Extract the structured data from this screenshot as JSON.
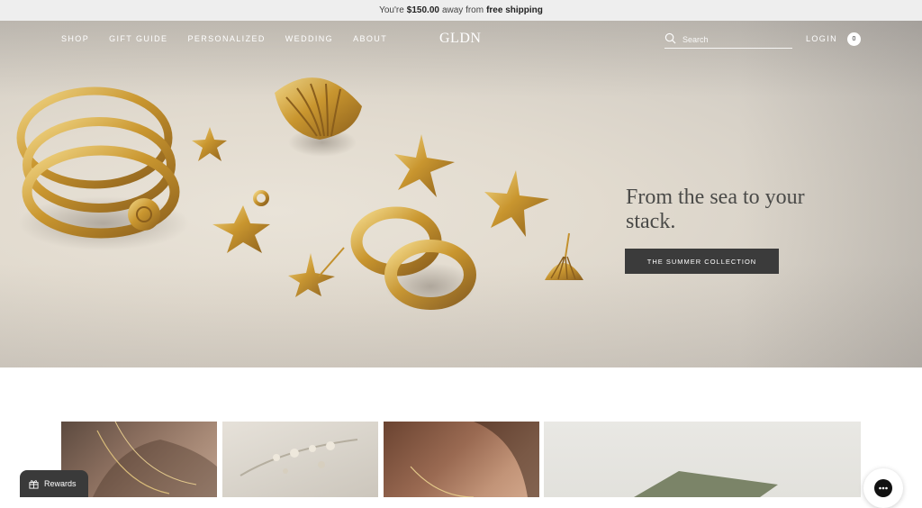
{
  "promo": {
    "prefix": "You're",
    "amount": "$150.00",
    "middle": "away from",
    "suffix": "free shipping"
  },
  "nav": {
    "links": [
      "SHOP",
      "GIFT GUIDE",
      "PERSONALIZED",
      "WEDDING",
      "ABOUT"
    ],
    "logo": "GLDN",
    "search_placeholder": "Search",
    "login": "LOGIN",
    "cart_count": "0"
  },
  "hero": {
    "title": "From the sea to your stack.",
    "cta": "THE SUMMER COLLECTION"
  },
  "rewards": {
    "label": "Rewards"
  },
  "colors": {
    "button_dark": "#3b3b3b",
    "promo_bg": "#eeeeee",
    "gold": "#c9a04a"
  },
  "icons": [
    "search-icon",
    "cart-icon",
    "gift-icon",
    "chat-icon"
  ]
}
